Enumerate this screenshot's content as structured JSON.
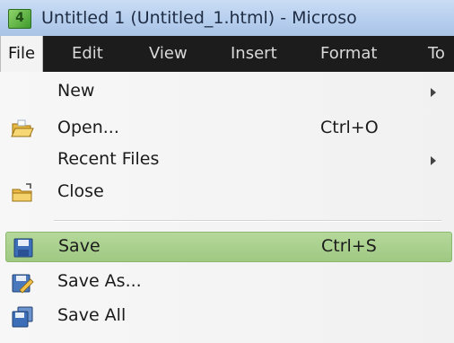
{
  "window": {
    "icon_letter": "4",
    "title": "Untitled 1 (Untitled_1.html) - Microso"
  },
  "menubar": {
    "items": [
      {
        "label": "File"
      },
      {
        "label": "Edit"
      },
      {
        "label": "View"
      },
      {
        "label": "Insert"
      },
      {
        "label": "Format"
      },
      {
        "label": "To"
      }
    ],
    "active": "File"
  },
  "file_menu": {
    "items": [
      {
        "label": "New",
        "shortcut": "",
        "submenu": true,
        "icon": "none"
      },
      {
        "label": "Open...",
        "shortcut": "Ctrl+O",
        "submenu": false,
        "icon": "open-folder-icon"
      },
      {
        "label": "Recent Files",
        "shortcut": "",
        "submenu": true,
        "icon": "none"
      },
      {
        "label": "Close",
        "shortcut": "",
        "submenu": false,
        "icon": "close-folder-icon"
      },
      {
        "label": "Save",
        "shortcut": "Ctrl+S",
        "submenu": false,
        "icon": "floppy-disk-icon",
        "highlighted": true
      },
      {
        "label": "Save As...",
        "shortcut": "",
        "submenu": false,
        "icon": "save-as-icon"
      },
      {
        "label": "Save All",
        "shortcut": "",
        "submenu": false,
        "icon": "save-all-icon"
      }
    ]
  },
  "colors": {
    "titlebar": "#b7cfee",
    "menubar": "#1c1c1c",
    "highlight": "#a8cf8c"
  }
}
